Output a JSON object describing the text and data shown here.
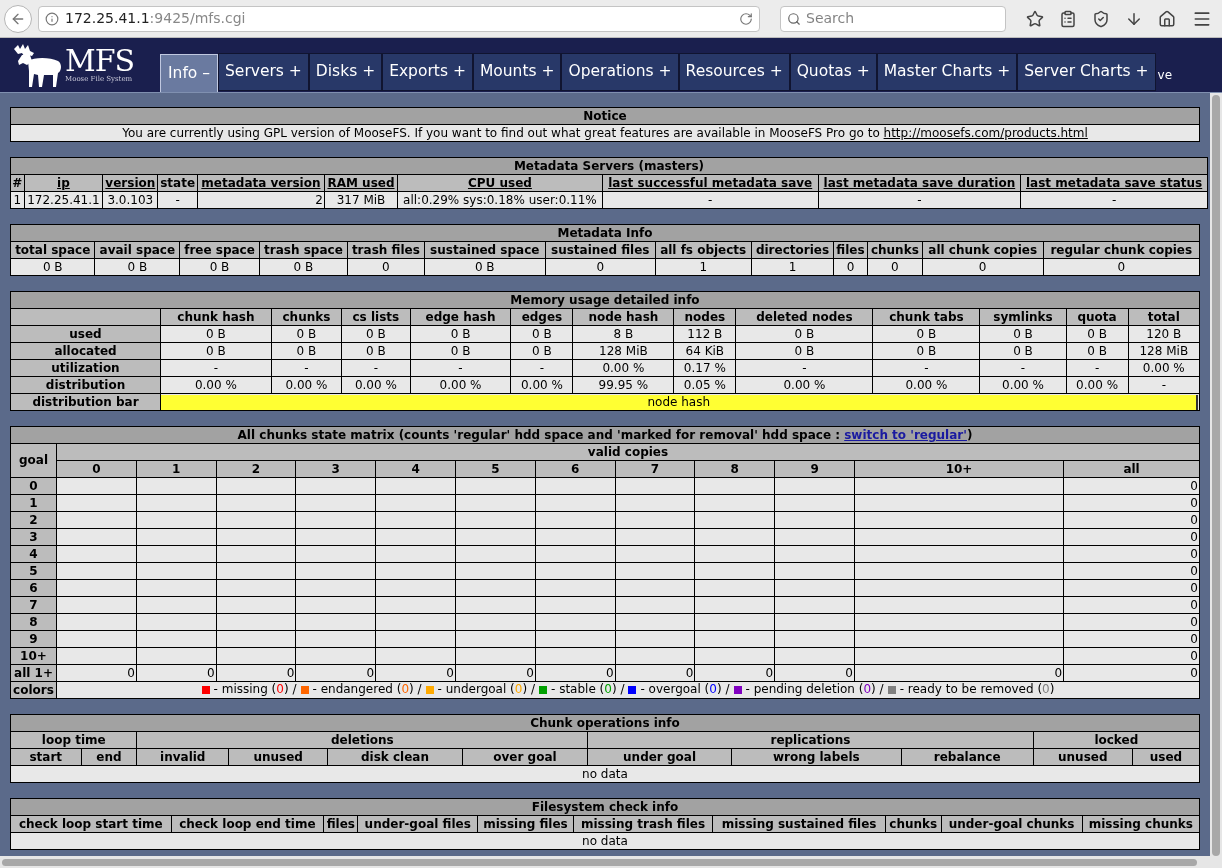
{
  "browser": {
    "url_host": "172.25.41.1",
    "url_rest": ":9425/mfs.cgi",
    "search": {
      "placeholder": "Search"
    }
  },
  "nav": {
    "logo_text": "MFS",
    "logo_subtitle": "Moose File System",
    "overflow_text": "ve",
    "tabs": [
      {
        "label": "Info –",
        "selected": true
      },
      {
        "label": "Servers +",
        "selected": false
      },
      {
        "label": "Disks +",
        "selected": false
      },
      {
        "label": "Exports +",
        "selected": false
      },
      {
        "label": "Mounts +",
        "selected": false
      },
      {
        "label": "Operations +",
        "selected": false
      },
      {
        "label": "Resources +",
        "selected": false
      },
      {
        "label": "Quotas +",
        "selected": false
      },
      {
        "label": "Master Charts +",
        "selected": false
      },
      {
        "label": "Server Charts +",
        "selected": false
      }
    ]
  },
  "notice": {
    "title": "Notice",
    "text": "You are currently using GPL version of MooseFS. If you want to find out what great features are available in MooseFS Pro go to",
    "link": "http://moosefs.com/products.html"
  },
  "metadata_servers": {
    "title": "Metadata Servers (masters)",
    "columns": [
      {
        "label": "#",
        "link": false
      },
      {
        "label": "ip",
        "link": true
      },
      {
        "label": "version",
        "link": true
      },
      {
        "label": "state",
        "link": false
      },
      {
        "label": "metadata version",
        "link": true
      },
      {
        "label": "RAM used",
        "link": true
      },
      {
        "label": "CPU used",
        "link": true
      },
      {
        "label": "last successful metadata save",
        "link": true
      },
      {
        "label": "last metadata save duration",
        "link": true
      },
      {
        "label": "last metadata save status",
        "link": true
      }
    ],
    "rows": [
      [
        "1",
        "172.25.41.1",
        "3.0.103",
        "-",
        "2",
        "317 MiB",
        "all:0.29% sys:0.18% user:0.11%",
        "-",
        "-",
        "-"
      ]
    ]
  },
  "metadata_info": {
    "title": "Metadata Info",
    "columns": [
      "total space",
      "avail space",
      "free space",
      "trash space",
      "trash files",
      "sustained space",
      "sustained files",
      "all fs objects",
      "directories",
      "files",
      "chunks",
      "all chunk copies",
      "regular chunk copies"
    ],
    "rows": [
      [
        "0 B",
        "0 B",
        "0 B",
        "0 B",
        "0",
        "0 B",
        "0",
        "1",
        "1",
        "0",
        "0",
        "0",
        "0"
      ]
    ]
  },
  "memory": {
    "title": "Memory usage detailed info",
    "columns": [
      "chunk hash",
      "chunks",
      "cs lists",
      "edge hash",
      "edges",
      "node hash",
      "nodes",
      "deleted nodes",
      "chunk tabs",
      "symlinks",
      "quota",
      "total"
    ],
    "rows": [
      {
        "label": "used",
        "values": [
          "0 B",
          "0 B",
          "0 B",
          "0 B",
          "0 B",
          "8 B",
          "112 B",
          "0 B",
          "0 B",
          "0 B",
          "0 B",
          "120 B"
        ]
      },
      {
        "label": "allocated",
        "values": [
          "0 B",
          "0 B",
          "0 B",
          "0 B",
          "0 B",
          "128 MiB",
          "64 KiB",
          "0 B",
          "0 B",
          "0 B",
          "0 B",
          "128 MiB"
        ]
      },
      {
        "label": "utilization",
        "values": [
          "-",
          "-",
          "-",
          "-",
          "-",
          "0.00 %",
          "0.17 %",
          "-",
          "-",
          "-",
          "-",
          "0.00 %"
        ]
      },
      {
        "label": "distribution",
        "values": [
          "0.00 %",
          "0.00 %",
          "0.00 %",
          "0.00 %",
          "0.00 %",
          "99.95 %",
          "0.05 %",
          "0.00 %",
          "0.00 %",
          "0.00 %",
          "0.00 %",
          "-"
        ]
      }
    ],
    "bar": {
      "label": "distribution bar",
      "segments": [
        {
          "text": "node hash",
          "level": 0.9995,
          "color": "#ffff33"
        }
      ]
    }
  },
  "matrix": {
    "title_text": "All chunks state matrix (counts 'regular' hdd space and 'marked for removal' hdd space :",
    "title_link": "switch to 'regular'",
    "title_end": ")",
    "goal_header": "goal",
    "group_header": "valid copies",
    "columns": [
      "0",
      "1",
      "2",
      "3",
      "4",
      "5",
      "6",
      "7",
      "8",
      "9",
      "10+",
      "all"
    ],
    "rows": [
      {
        "label": "0",
        "cells": [
          null,
          null,
          null,
          null,
          null,
          null,
          null,
          null,
          null,
          null,
          null,
          "0"
        ]
      },
      {
        "label": "1",
        "cells": [
          null,
          null,
          null,
          null,
          null,
          null,
          null,
          null,
          null,
          null,
          null,
          "0"
        ]
      },
      {
        "label": "2",
        "cells": [
          null,
          null,
          null,
          null,
          null,
          null,
          null,
          null,
          null,
          null,
          null,
          "0"
        ]
      },
      {
        "label": "3",
        "cells": [
          null,
          null,
          null,
          null,
          null,
          null,
          null,
          null,
          null,
          null,
          null,
          "0"
        ]
      },
      {
        "label": "4",
        "cells": [
          null,
          null,
          null,
          null,
          null,
          null,
          null,
          null,
          null,
          null,
          null,
          "0"
        ]
      },
      {
        "label": "5",
        "cells": [
          null,
          null,
          null,
          null,
          null,
          null,
          null,
          null,
          null,
          null,
          null,
          "0"
        ]
      },
      {
        "label": "6",
        "cells": [
          null,
          null,
          null,
          null,
          null,
          null,
          null,
          null,
          null,
          null,
          null,
          "0"
        ]
      },
      {
        "label": "7",
        "cells": [
          null,
          null,
          null,
          null,
          null,
          null,
          null,
          null,
          null,
          null,
          null,
          "0"
        ]
      },
      {
        "label": "8",
        "cells": [
          null,
          null,
          null,
          null,
          null,
          null,
          null,
          null,
          null,
          null,
          null,
          "0"
        ]
      },
      {
        "label": "9",
        "cells": [
          null,
          null,
          null,
          null,
          null,
          null,
          null,
          null,
          null,
          null,
          null,
          "0"
        ]
      },
      {
        "label": "10+",
        "cells": [
          null,
          null,
          null,
          null,
          null,
          null,
          null,
          null,
          null,
          null,
          null,
          "0"
        ]
      },
      {
        "label": "all 1+",
        "cells": [
          "0",
          "0",
          "0",
          "0",
          "0",
          "0",
          "0",
          "0",
          "0",
          "0",
          "0",
          "0"
        ]
      }
    ],
    "colors_label": "colors",
    "legend": [
      {
        "color": "#ff0000",
        "before": "- missing (",
        "count": "0",
        "after": ") /"
      },
      {
        "color": "#ff6600",
        "before": "- endangered (",
        "count": "0",
        "after": ") /"
      },
      {
        "color": "#ffaa00",
        "before": "- undergoal (",
        "count": "0",
        "after": ") /"
      },
      {
        "color": "#00a000",
        "before": "- stable (",
        "count": "0",
        "after": ") /"
      },
      {
        "color": "#0000ff",
        "before": "- overgoal (",
        "count": "0",
        "after": ") /"
      },
      {
        "color": "#8000c0",
        "before": "- pending deletion (",
        "count": "0",
        "after": ") /"
      },
      {
        "color": "#808080",
        "before": "- ready to be removed (",
        "count": "0",
        "after": ")"
      }
    ]
  },
  "chunk_operations": {
    "title": "Chunk operations info",
    "groups": [
      {
        "label": "loop time",
        "columns": [
          "start",
          "end"
        ]
      },
      {
        "label": "deletions",
        "columns": [
          "invalid",
          "unused",
          "disk clean",
          "over goal"
        ]
      },
      {
        "label": "replications",
        "columns": [
          "under goal",
          "wrong labels",
          "rebalance"
        ]
      },
      {
        "label": "locked",
        "columns": [
          "unused",
          "used"
        ]
      }
    ],
    "empty": "no data"
  },
  "filesystem_check": {
    "title": "Filesystem check info",
    "columns": [
      "check loop start time",
      "check loop end time",
      "files",
      "under-goal files",
      "missing files",
      "missing trash files",
      "missing sustained files",
      "chunks",
      "under-goal chunks",
      "missing chunks"
    ],
    "empty": "no data"
  }
}
